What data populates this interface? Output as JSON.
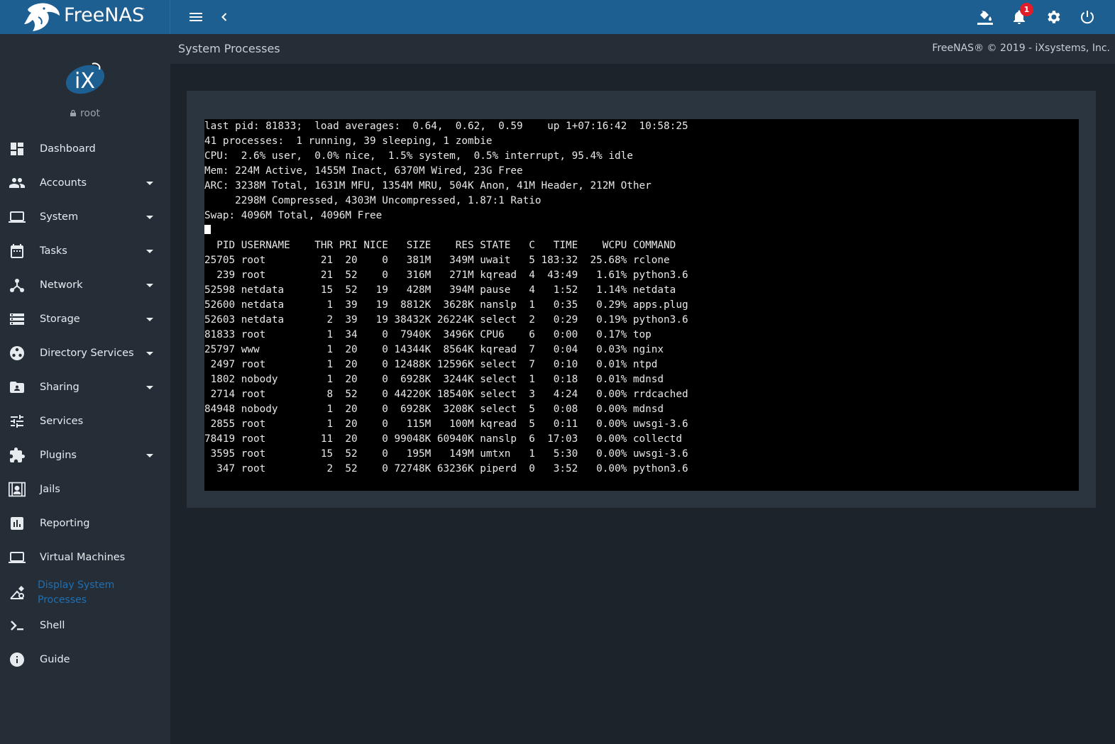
{
  "brand": {
    "name": "FreeNAS",
    "tm": "™"
  },
  "header": {
    "notification_count": "1",
    "page_title": "System Processes",
    "copyright": "FreeNAS® © 2019 - iXsystems, Inc."
  },
  "user": {
    "name": "root"
  },
  "sidebar": {
    "items": [
      {
        "label": "Dashboard",
        "icon": "dashboard-icon",
        "has_children": false
      },
      {
        "label": "Accounts",
        "icon": "accounts-icon",
        "has_children": true
      },
      {
        "label": "System",
        "icon": "laptop-icon",
        "has_children": true
      },
      {
        "label": "Tasks",
        "icon": "calendar-icon",
        "has_children": true
      },
      {
        "label": "Network",
        "icon": "network-icon",
        "has_children": true
      },
      {
        "label": "Storage",
        "icon": "storage-icon",
        "has_children": true
      },
      {
        "label": "Directory Services",
        "icon": "directory-icon",
        "has_children": true
      },
      {
        "label": "Sharing",
        "icon": "folder-share-icon",
        "has_children": true
      },
      {
        "label": "Services",
        "icon": "tune-icon",
        "has_children": false
      },
      {
        "label": "Plugins",
        "icon": "puzzle-icon",
        "has_children": true
      },
      {
        "label": "Jails",
        "icon": "jail-icon",
        "has_children": false
      },
      {
        "label": "Reporting",
        "icon": "chart-icon",
        "has_children": false
      },
      {
        "label": "Virtual Machines",
        "icon": "laptop-icon",
        "has_children": false
      },
      {
        "label": "Display System Processes",
        "label_line1": "Display System",
        "label_line2": "Processes",
        "icon": "processes-icon",
        "has_children": false,
        "active": true
      },
      {
        "label": "Shell",
        "icon": "console-icon",
        "has_children": false
      },
      {
        "label": "Guide",
        "icon": "info-icon",
        "has_children": false
      }
    ]
  },
  "terminal": {
    "lines": [
      "last pid: 81833;  load averages:  0.64,  0.62,  0.59    up 1+07:16:42  10:58:25",
      "41 processes:  1 running, 39 sleeping, 1 zombie",
      "CPU:  2.6% user,  0.0% nice,  1.5% system,  0.5% interrupt, 95.4% idle",
      "Mem: 224M Active, 1455M Inact, 6370M Wired, 23G Free",
      "ARC: 3238M Total, 1631M MFU, 1354M MRU, 504K Anon, 41M Header, 212M Other",
      "     2298M Compressed, 4303M Uncompressed, 1.87:1 Ratio",
      "Swap: 4096M Total, 4096M Free",
      "",
      "  PID USERNAME    THR PRI NICE   SIZE    RES STATE   C   TIME    WCPU COMMAND",
      "25705 root         21  20    0   381M   349M uwait   5 183:32  25.68% rclone",
      "  239 root         21  52    0   316M   271M kqread  4  43:49   1.61% python3.6",
      "52598 netdata      15  52   19   428M   394M pause   4   1:52   1.14% netdata",
      "52600 netdata       1  39   19  8812K  3628K nanslp  1   0:35   0.29% apps.plug",
      "52603 netdata       2  39   19 38432K 26224K select  2   0:29   0.19% python3.6",
      "81833 root          1  34    0  7940K  3496K CPU6    6   0:00   0.17% top",
      "25797 www           1  20    0 14344K  8564K kqread  7   0:04   0.03% nginx",
      " 2497 root          1  20    0 12488K 12596K select  7   0:10   0.01% ntpd",
      " 1802 nobody        1  20    0  6928K  3244K select  1   0:18   0.01% mdnsd",
      " 2714 root          8  52    0 44220K 18540K select  3   4:24   0.00% rrdcached",
      "84948 nobody        1  20    0  6928K  3208K select  5   0:08   0.00% mdnsd",
      " 2855 root          1  20    0   115M   100M kqread  5   0:11   0.00% uwsgi-3.6",
      "78419 root         11  20    0 99048K 60940K nanslp  6  17:03   0.00% collectd",
      " 3595 root         15  52    0   195M   149M umtxn   1   5:30   0.00% uwsgi-3.6",
      "  347 root          2  52    0 72748K 63236K piperd  0   3:52   0.00% python3.6"
    ]
  }
}
